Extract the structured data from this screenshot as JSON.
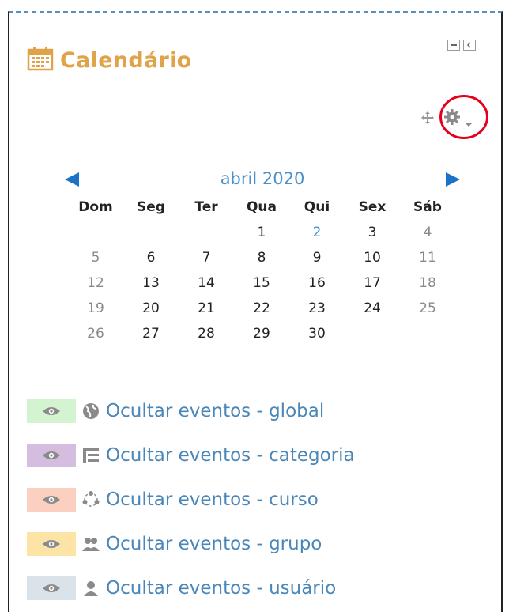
{
  "block": {
    "title": "Calendário",
    "dock_controls": [
      "collapse",
      "dock"
    ]
  },
  "calendar": {
    "month_label": "abril 2020",
    "weekdays": [
      "Dom",
      "Seg",
      "Ter",
      "Qua",
      "Qui",
      "Sex",
      "Sáb"
    ],
    "weeks": [
      [
        "",
        "",
        "",
        "1",
        "2",
        "3",
        "4"
      ],
      [
        "5",
        "6",
        "7",
        "8",
        "9",
        "10",
        "11"
      ],
      [
        "12",
        "13",
        "14",
        "15",
        "16",
        "17",
        "18"
      ],
      [
        "19",
        "20",
        "21",
        "22",
        "23",
        "24",
        "25"
      ],
      [
        "26",
        "27",
        "28",
        "29",
        "30",
        "",
        ""
      ]
    ]
  },
  "legend": [
    {
      "label": "Ocultar eventos - global",
      "color": "#d4f3d0",
      "icon": "globe-icon"
    },
    {
      "label": "Ocultar eventos - categoria",
      "color": "#d5bde0",
      "icon": "category-icon"
    },
    {
      "label": "Ocultar eventos - curso",
      "color": "#fbd0c0",
      "icon": "course-icon"
    },
    {
      "label": "Ocultar eventos - grupo",
      "color": "#fbe4a5",
      "icon": "group-icon"
    },
    {
      "label": "Ocultar eventos - usuário",
      "color": "#dbe3ea",
      "icon": "user-icon"
    }
  ],
  "colors": {
    "title": "#e0a34a",
    "link": "#4a86b8",
    "annotation": "#e5001d"
  }
}
